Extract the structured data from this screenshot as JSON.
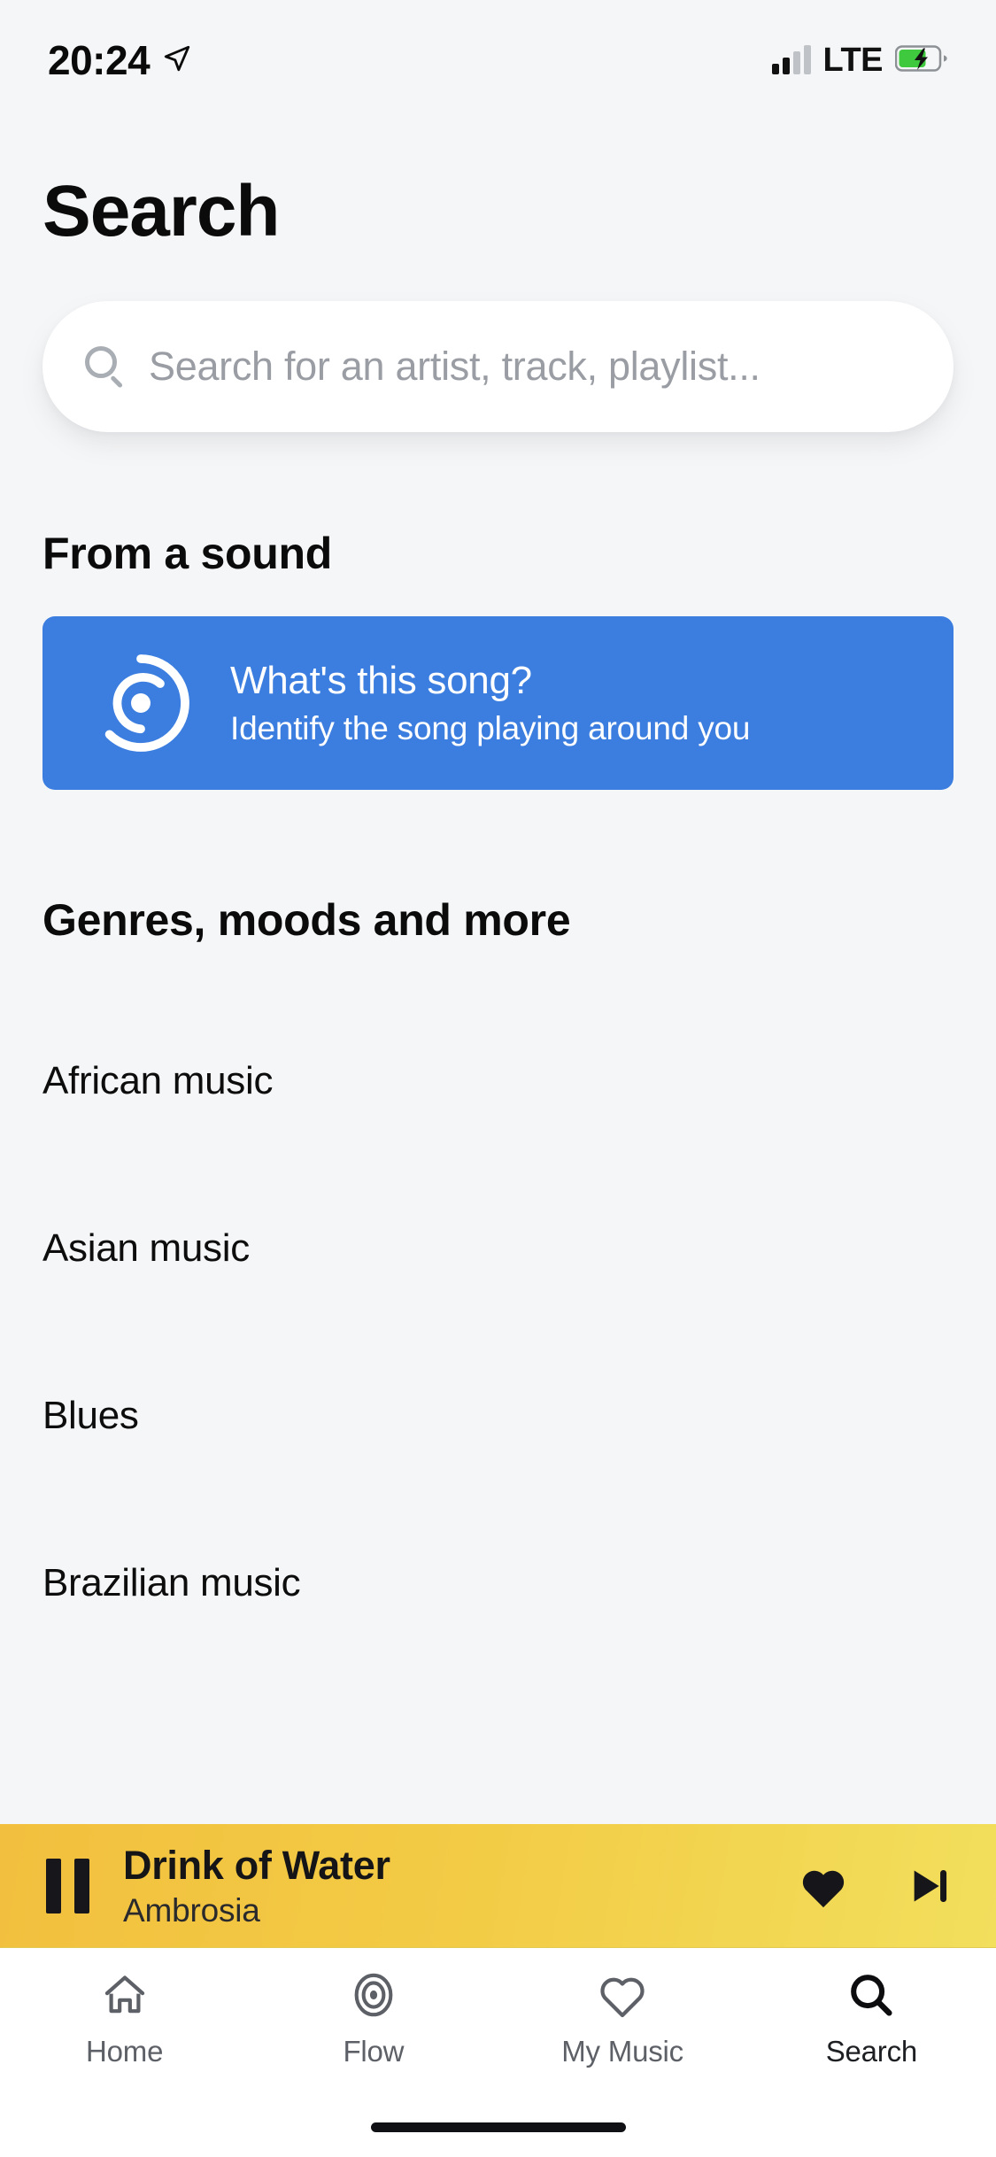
{
  "status_bar": {
    "time": "20:24",
    "location_icon": "location-arrow-icon",
    "network": "LTE",
    "signal_bars_filled": 2,
    "signal_bars_total": 4,
    "battery_icon": "battery-charging-icon",
    "battery_color": "#3ec93e"
  },
  "header": {
    "title": "Search"
  },
  "search": {
    "icon": "search-icon",
    "placeholder": "Search for an artist, track, playlist...",
    "value": ""
  },
  "from_sound": {
    "heading": "From a sound",
    "card": {
      "icon": "soundhound-listen-icon",
      "title": "What's this song?",
      "subtitle": "Identify the song playing around you",
      "background_color": "#3c7ee0",
      "text_color": "#ffffff"
    }
  },
  "genres_section": {
    "heading": "Genres, moods and more",
    "items": [
      {
        "label": "African music"
      },
      {
        "label": "Asian music"
      },
      {
        "label": "Blues"
      },
      {
        "label": "Brazilian music"
      }
    ]
  },
  "player": {
    "play_state_icon": "pause-icon",
    "track_title": "Drink of Water",
    "artist": "Ambrosia",
    "favorite_icon": "heart-filled-icon",
    "favorited": true,
    "next_icon": "skip-next-icon",
    "gradient_from": "#f2c03e",
    "gradient_to": "#f2df5c"
  },
  "tab_bar": {
    "active": "Search",
    "tabs": [
      {
        "label": "Home",
        "icon": "home-icon"
      },
      {
        "label": "Flow",
        "icon": "flow-target-icon"
      },
      {
        "label": "My Music",
        "icon": "heart-outline-icon"
      },
      {
        "label": "Search",
        "icon": "search-icon"
      }
    ]
  }
}
